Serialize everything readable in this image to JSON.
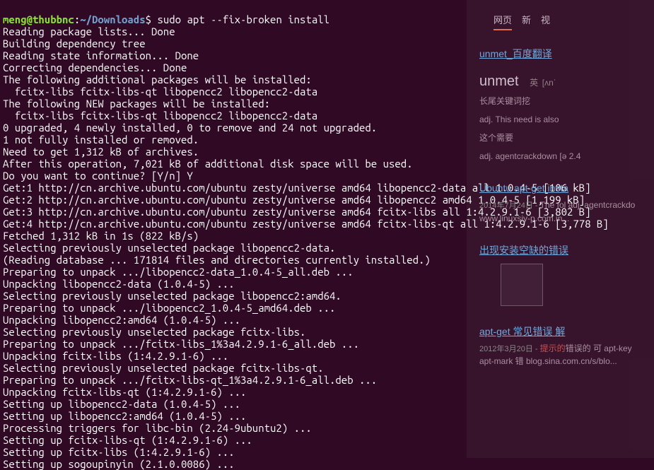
{
  "prompt": {
    "user": "meng@thubbnc",
    "separator1": ":",
    "path": "~/Downloads",
    "separator2": "$ ",
    "command": "sudo apt --fix-broken install"
  },
  "lines": [
    "Reading package lists... Done",
    "Building dependency tree",
    "Reading state information... Done",
    "Correcting dependencies... Done",
    "The following additional packages will be installed:",
    "  fcitx-libs fcitx-libs-qt libopencc2 libopencc2-data",
    "The following NEW packages will be installed:",
    "  fcitx-libs fcitx-libs-qt libopencc2 libopencc2-data",
    "0 upgraded, 4 newly installed, 0 to remove and 24 not upgraded.",
    "1 not fully installed or removed.",
    "Need to get 1,312 kB of archives.",
    "After this operation, 7,021 kB of additional disk space will be used.",
    "Do you want to continue? [Y/n] Y",
    "Get:1 http://cn.archive.ubuntu.com/ubuntu zesty/universe amd64 libopencc2-data all 1.0.4-5 [106 kB]",
    "Get:2 http://cn.archive.ubuntu.com/ubuntu zesty/universe amd64 libopencc2 amd64 1.0.4-5 [1,199 kB]",
    "Get:3 http://cn.archive.ubuntu.com/ubuntu zesty/universe amd64 fcitx-libs all 1:4.2.9.1-6 [3,802 B]",
    "Get:4 http://cn.archive.ubuntu.com/ubuntu zesty/universe amd64 fcitx-libs-qt all 1:4.2.9.1-6 [3,778 B]",
    "Fetched 1,312 kB in 1s (822 kB/s)",
    "Selecting previously unselected package libopencc2-data.",
    "(Reading database ... 171814 files and directories currently installed.)",
    "Preparing to unpack .../libopencc2-data_1.0.4-5_all.deb ...",
    "Unpacking libopencc2-data (1.0.4-5) ...",
    "Selecting previously unselected package libopencc2:amd64.",
    "Preparing to unpack .../libopencc2_1.0.4-5_amd64.deb ...",
    "Unpacking libopencc2:amd64 (1.0.4-5) ...",
    "Selecting previously unselected package fcitx-libs.",
    "Preparing to unpack .../fcitx-libs_1%3a4.2.9.1-6_all.deb ...",
    "Unpacking fcitx-libs (1:4.2.9.1-6) ...",
    "Selecting previously unselected package fcitx-libs-qt.",
    "Preparing to unpack .../fcitx-libs-qt_1%3a4.2.9.1-6_all.deb ...",
    "Unpacking fcitx-libs-qt (1:4.2.9.1-6) ...",
    "Setting up libopencc2-data (1.0.4-5) ...",
    "Setting up libopencc2:amd64 (1.0.4-5) ...",
    "Processing triggers for libc-bin (2.24-9ubuntu2) ...",
    "Setting up fcitx-libs-qt (1:4.2.9.1-6) ...",
    "Setting up fcitx-libs (1:4.2.9.1-6) ...",
    "Setting up sogoupinyin (2.1.0.0086) ..."
  ],
  "right": {
    "tabs": [
      "网页",
      "新",
      "视"
    ],
    "search_link": "unmet_百度翻译",
    "big_title": "unmet",
    "ann1": "英",
    "ann2": "[ʌnˈ",
    "faded1": "长尾关键词挖",
    "faded2": "adj. This need is also",
    "faded3": "这个需要",
    "faded4": "adj. agentcrackdown [ə 2.4",
    "result1_title": "Ubuntu apt-get insta",
    "result1_date": "2014年7月24日 - ",
    "result1_snippet": "The fol  adj. agentcrackdo  www.linuxsiy-p.com.in...",
    "result2_title": "出现安装空缺的错误",
    "result3_title": "apt-get 常见错误  解",
    "result3_date": "2012年3月20日 - ",
    "result3_snippet": "错误的  可 apt-key apt-mark 错  blog.sina.com.cn/s/blo...",
    "highlight_word": "提示的"
  }
}
